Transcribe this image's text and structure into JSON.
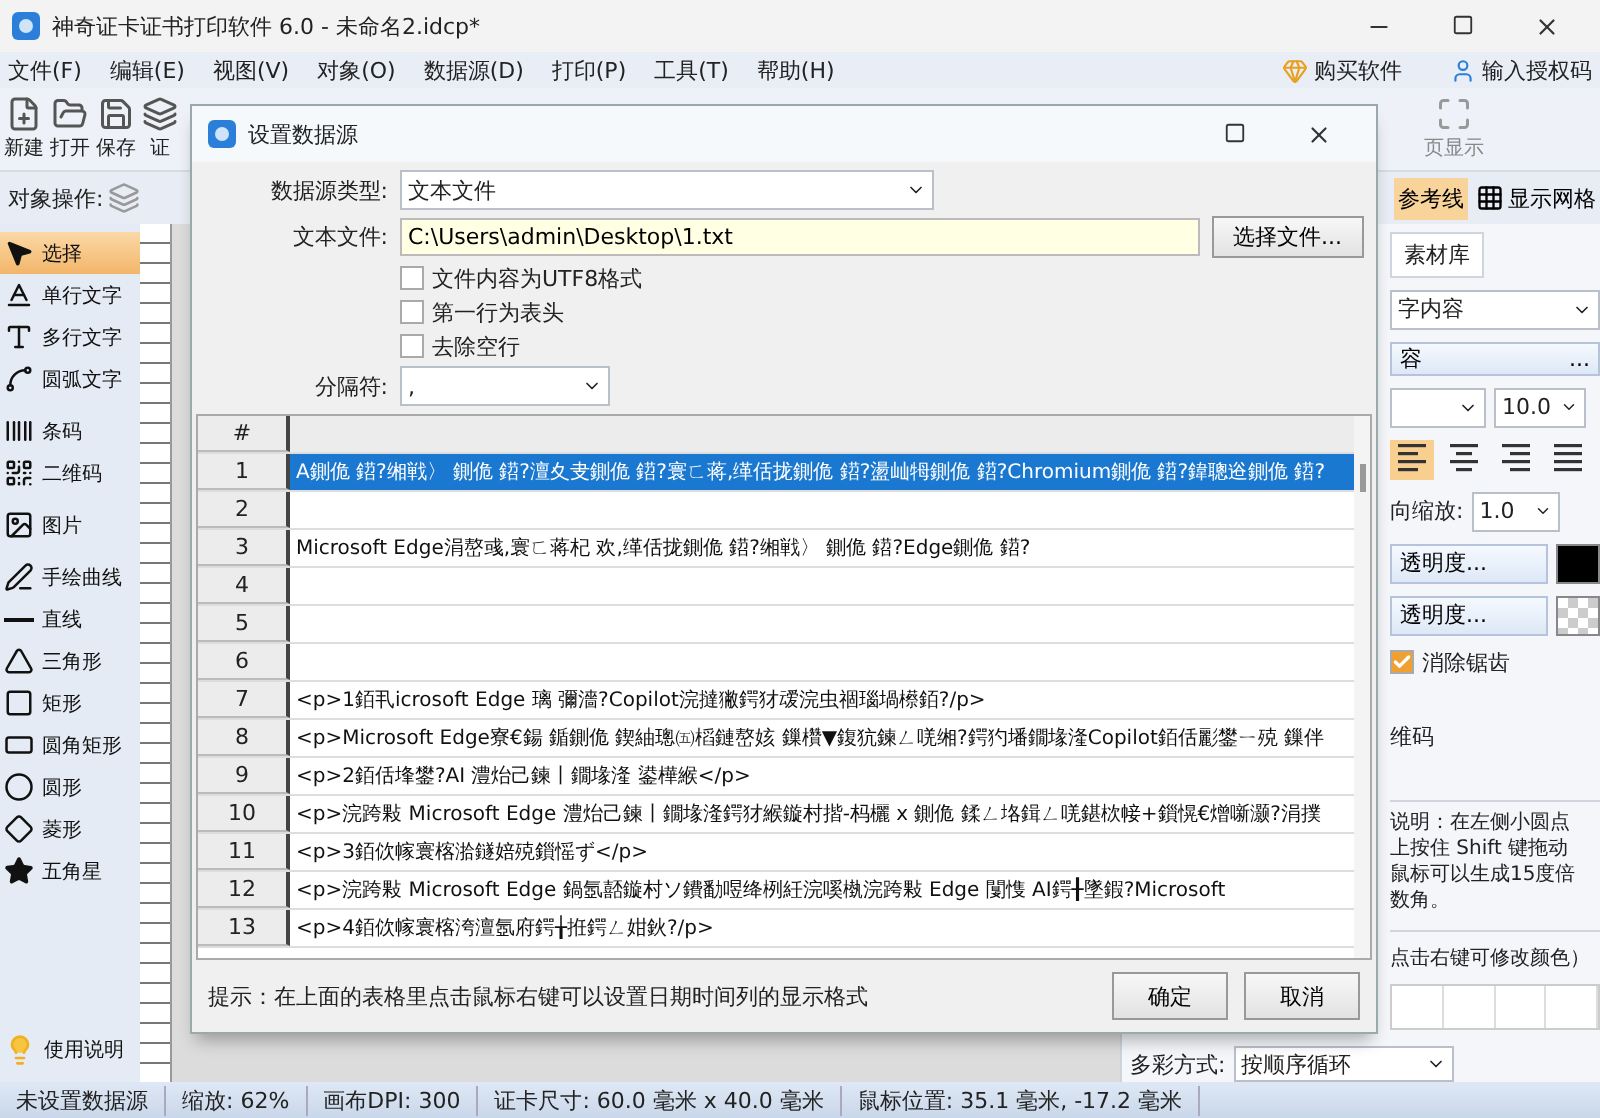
{
  "window": {
    "title": "神奇证卡证书打印软件 6.0 - 未命名2.idcp*"
  },
  "menu": [
    "文件(F)",
    "编辑(E)",
    "视图(V)",
    "对象(O)",
    "数据源(D)",
    "打印(P)",
    "工具(T)",
    "帮助(H)"
  ],
  "menu_right": [
    "购买软件",
    "输入授权码"
  ],
  "toolbar": [
    "新建",
    "打开",
    "保存",
    "证"
  ],
  "toolbar_right": "页显示",
  "object_bar": {
    "label": "对象操作:",
    "guides": "参考线",
    "grid": "显示网格"
  },
  "tools": [
    {
      "label": "选择",
      "selected": true
    },
    {
      "label": "单行文字",
      "selected": false
    },
    {
      "label": "多行文字",
      "selected": false
    },
    {
      "label": "圆弧文字",
      "selected": false
    },
    {
      "label": "条码",
      "selected": false
    },
    {
      "label": "二维码",
      "selected": false
    },
    {
      "label": "图片",
      "selected": false
    },
    {
      "label": "手绘曲线",
      "selected": false
    },
    {
      "label": "直线",
      "selected": false
    },
    {
      "label": "三角形",
      "selected": false
    },
    {
      "label": "矩形",
      "selected": false
    },
    {
      "label": "圆角矩形",
      "selected": false
    },
    {
      "label": "圆形",
      "selected": false
    },
    {
      "label": "菱形",
      "selected": false
    },
    {
      "label": "五角星",
      "selected": false
    }
  ],
  "help": "使用说明",
  "right_panel": {
    "tab": "素材库",
    "content_select": "字内容",
    "content_button": "容",
    "content_button_more": "...",
    "font_size": "10.0",
    "align": [
      {
        "selected": true
      },
      {
        "selected": false
      },
      {
        "selected": false
      },
      {
        "selected": false
      }
    ],
    "scale_label": "向缩放:",
    "scale": "1.0",
    "fill_button": "透明度...",
    "stroke_button": "透明度...",
    "antialias": {
      "label": "消除锯齿",
      "checked": true
    },
    "qr_label": "维码",
    "note": [
      "说明：在左侧小圆点",
      "上按住 Shift 键拖动",
      "鼠标可以生成15度倍",
      "数角。"
    ],
    "color_hint": "点击右键可修改颜色）",
    "multi_label": "多彩方式:",
    "multi_value": "按顺序循环"
  },
  "dialog": {
    "title": "设置数据源",
    "type_label": "数据源类型:",
    "type_value": "文本文件",
    "file_label": "文本文件:",
    "file_value": "C:\\Users\\admin\\Desktop\\1.txt",
    "browse": "选择文件...",
    "options": [
      {
        "label": "文件内容为UTF8格式",
        "checked": false
      },
      {
        "label": "第一行为表头",
        "checked": false
      },
      {
        "label": "去除空行",
        "checked": false
      }
    ],
    "separator_label": "分隔符:",
    "separator_value": ",",
    "table": {
      "columns": [
        "#"
      ],
      "rows": [
        {
          "number": "1",
          "text": "A鍘佹 鍣?缃戦〉 鍘佹 鍣?澶夊叏鍘佹 鍣?寰ㄈ蒋,缂佸拢鍘佹 鍣?盪屾牳鍘佹 鍣?Chromium鍘佹 鍣?鍏聰逧鍘佹 鍣?",
          "selected": true
        },
        {
          "number": "2",
          "selected": false
        },
        {
          "number": "3",
          "text": "Microsoft Edge涓嶅彧,寰ㄈ蒋杞 欢,缂佸拢鍘佹 鍣?缃戦〉 鍘佹 鍣?Edge鍘佹 鍣?",
          "selected": false
        },
        {
          "number": "4",
          "selected": false
        },
        {
          "number": "5",
          "selected": false
        },
        {
          "number": "6",
          "selected": false
        },
        {
          "number": "7",
          "text": "<p>1銆丮icrosoft Edge 璃 彌濇?Copilot浣撻獙鍔犲叆浣虫祻瑙堝櫒銆?/p>",
          "selected": false
        },
        {
          "number": "8",
          "text": "<p>Microsoft Edge寮€鍚 鍎鍘佹 鍥紬璁㈤槄鏈嶅姟 鏁欑▼鍑犺鍊ㄥ唴缃?鍔犳墦鐗堟湰Copilot銆佸彲鐢ㄧ殑 鏁伴",
          "selected": false
        },
        {
          "number": "9",
          "text": "<p>2銆佸埄鐢?AI 澧炲己鍊丨鐗堟湰 鍙樺緱</p>",
          "selected": false
        },
        {
          "number": "10",
          "text": "<p>浣跨敤 Microsoft Edge 澧炲己鍊丨鐗堟湰鍔犲緱鏇村揩-杩欐 x 鍘佹 鍒ㄥ垎鍓ㄥ唴鍖栨帹+鎻愰€熷噺灏?涓撲",
          "selected": false
        },
        {
          "number": "11",
          "text": "<p>3銆佽幏寰楁湁鐩婄殑鎻愮ず</p>",
          "selected": false
        },
        {
          "number": "12",
          "text": "<p>浣跨敤 Microsoft Edge 鍋氬嚭鏇村ソ鐨勫喅绛栵紝浣嗘槸浣跨敤 Edge 闅愯 AI鍔╂墜鍜?Microsoft",
          "selected": false
        },
        {
          "number": "13",
          "text": "<p>4銆佽幏寰楁洿澶氬府鍔╁拰鍔ㄥ姏鈥?/p>",
          "selected": false
        }
      ]
    },
    "hint": "提示：在上面的表格里点击鼠标右键可以设置日期时间列的显示格式",
    "ok": "确定",
    "cancel": "取消"
  },
  "status_bar": [
    "未设置数据源",
    "缩放: 62%",
    "画布DPI: 300",
    "证卡尺寸: 60.0 毫米 x 40.0 毫米",
    "鼠标位置: 35.1 毫米, -17.2 毫米"
  ]
}
